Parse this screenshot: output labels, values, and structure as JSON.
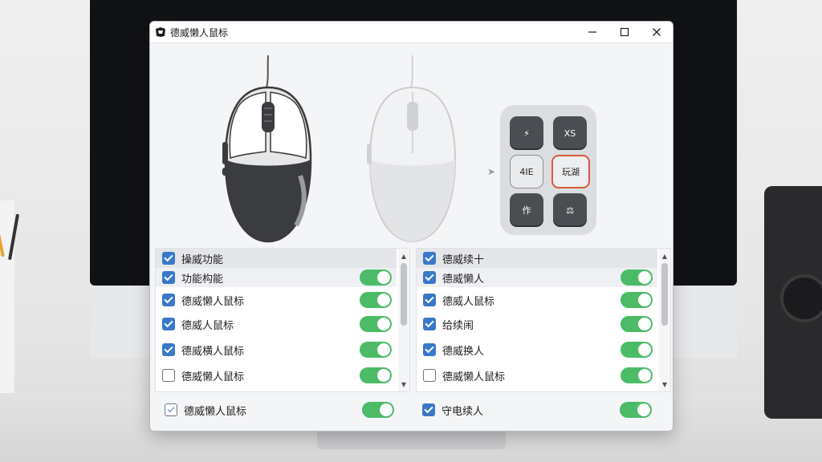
{
  "window": {
    "title": "德威懒人鼠标",
    "controls": {
      "minimize": "—",
      "maximize": "☐",
      "close": "✕"
    }
  },
  "keypad": {
    "keys": [
      {
        "label": "⚡",
        "style": "dark"
      },
      {
        "label": "XS",
        "style": "dark"
      },
      {
        "label": "4IE",
        "style": "light"
      },
      {
        "label": "玩湖",
        "style": "highlight"
      },
      {
        "label": "作",
        "style": "dark"
      },
      {
        "label": "⚖",
        "style": "dark"
      }
    ],
    "pointer": "➤"
  },
  "left_panel": {
    "header": {
      "label": "操威功能",
      "checked": true
    },
    "items": [
      {
        "label": "功能构能",
        "checked": true,
        "toggle": true
      },
      {
        "label": "德威懒人鼠标",
        "checked": true,
        "toggle": true
      },
      {
        "label": "德威人鼠标",
        "checked": true,
        "toggle": true
      },
      {
        "label": "德威横人鼠标",
        "checked": true,
        "toggle": true
      },
      {
        "label": "德威懒人鼠标",
        "checked": false,
        "toggle": true
      }
    ],
    "footer": {
      "label": "德威懒人鼠标",
      "checked": true,
      "toggle": true
    }
  },
  "right_panel": {
    "header": {
      "label": "德威续十",
      "checked": true
    },
    "items": [
      {
        "label": "德威懒人",
        "checked": true,
        "toggle": true
      },
      {
        "label": "德威人鼠标",
        "checked": true,
        "toggle": true
      },
      {
        "label": "给续闹",
        "checked": true,
        "toggle": true
      },
      {
        "label": "德威换人",
        "checked": true,
        "toggle": true
      },
      {
        "label": "德威懒人鼠标",
        "checked": false,
        "toggle": true
      }
    ],
    "footer": {
      "label": "守电续人",
      "checked": true,
      "toggle": true
    }
  },
  "colors": {
    "accent": "#3a78c8",
    "toggle_on": "#4cbb68",
    "highlight_key_border": "#d95a3a"
  }
}
